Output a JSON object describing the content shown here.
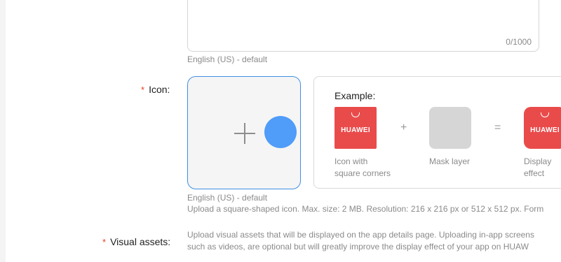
{
  "description_field": {
    "counter": "0/1000",
    "language_note": "English (US) - default"
  },
  "icon_field": {
    "required_mark": "*",
    "label": "Icon:",
    "language_note": "English (US) - default",
    "hint": "Upload a square-shaped icon. Max. size: 2 MB. Resolution: 216 x 216 px or 512 x 512 px. Form",
    "example": {
      "title": "Example:",
      "brand_text": "HUAWEI",
      "plus_op": "+",
      "equals_op": "=",
      "captions": {
        "square": [
          "Icon with",
          "square corners"
        ],
        "mask": [
          "Mask layer"
        ],
        "display": [
          "Display",
          "effect"
        ]
      }
    }
  },
  "visual_assets_field": {
    "required_mark": "*",
    "label": "Visual assets:",
    "hint_line1": "Upload visual assets that will be displayed on the app details page. Uploading in-app screens",
    "hint_line2": "such as videos, are optional but will greatly improve the display effect of your app on HUAW"
  },
  "colors": {
    "required": "#e84026",
    "accent": "#3f8fe6",
    "brand_red": "#e94b4b"
  }
}
